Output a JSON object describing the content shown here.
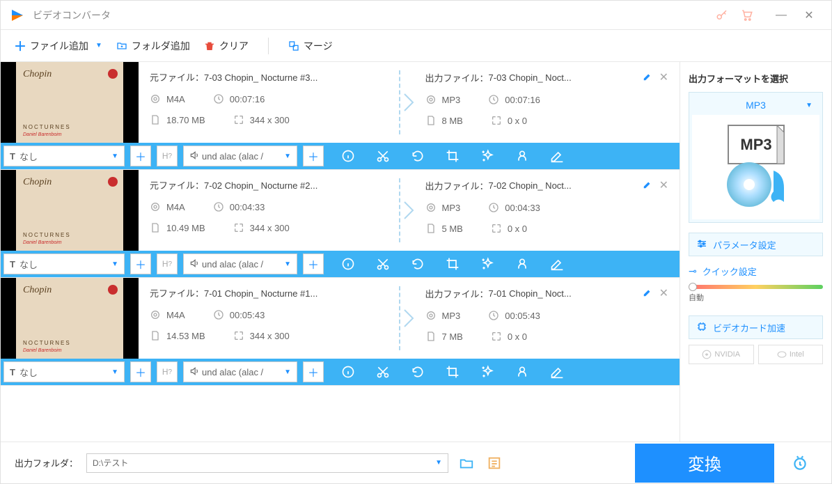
{
  "app": {
    "title": "ビデオコンバータ"
  },
  "toolbar": {
    "add_file": "ファイル追加",
    "add_folder": "フォルダ追加",
    "clear": "クリア",
    "merge": "マージ"
  },
  "files": [
    {
      "thumb_brand": "Chopin",
      "thumb_text": "NOCTURNES",
      "thumb_sub": "Daniel Barenboim",
      "src_label": "元ファイル：",
      "src_name": "7-03 Chopin_ Nocturne #3...",
      "src_format": "M4A",
      "src_duration": "00:07:16",
      "src_size": "18.70 MB",
      "src_dims": "344 x 300",
      "out_label": "出力ファイル：",
      "out_name": "7-03 Chopin_ Noct...",
      "out_format": "MP3",
      "out_duration": "00:07:16",
      "out_size": "8 MB",
      "out_dims": "0 x 0",
      "subtitle_select": "なし",
      "audio_select": "und alac (alac /"
    },
    {
      "thumb_brand": "Chopin",
      "thumb_text": "NOCTURNES",
      "thumb_sub": "Daniel Barenboim",
      "src_label": "元ファイル：",
      "src_name": "7-02 Chopin_ Nocturne #2...",
      "src_format": "M4A",
      "src_duration": "00:04:33",
      "src_size": "10.49 MB",
      "src_dims": "344 x 300",
      "out_label": "出力ファイル：",
      "out_name": "7-02 Chopin_ Noct...",
      "out_format": "MP3",
      "out_duration": "00:04:33",
      "out_size": "5 MB",
      "out_dims": "0 x 0",
      "subtitle_select": "なし",
      "audio_select": "und alac (alac /"
    },
    {
      "thumb_brand": "Chopin",
      "thumb_text": "NOCTURNES",
      "thumb_sub": "Daniel Barenboim",
      "src_label": "元ファイル：",
      "src_name": "7-01 Chopin_ Nocturne #1...",
      "src_format": "M4A",
      "src_duration": "00:05:43",
      "src_size": "14.53 MB",
      "src_dims": "344 x 300",
      "out_label": "出力ファイル：",
      "out_name": "7-01 Chopin_ Noct...",
      "out_format": "MP3",
      "out_duration": "00:05:43",
      "out_size": "7 MB",
      "out_dims": "0 x 0",
      "subtitle_select": "なし",
      "audio_select": "und alac (alac /"
    }
  ],
  "side": {
    "title": "出力フォーマットを選択",
    "format": "MP3",
    "param_settings": "パラメータ設定",
    "quick_settings": "クイック設定",
    "slider_label": "自動",
    "gpu_accel": "ビデオカード加速",
    "vendor_nvidia": "NVIDIA",
    "vendor_intel": "Intel"
  },
  "bottom": {
    "out_folder_label": "出力フォルダ：",
    "out_folder_value": "D:\\テスト",
    "convert": "変換"
  }
}
